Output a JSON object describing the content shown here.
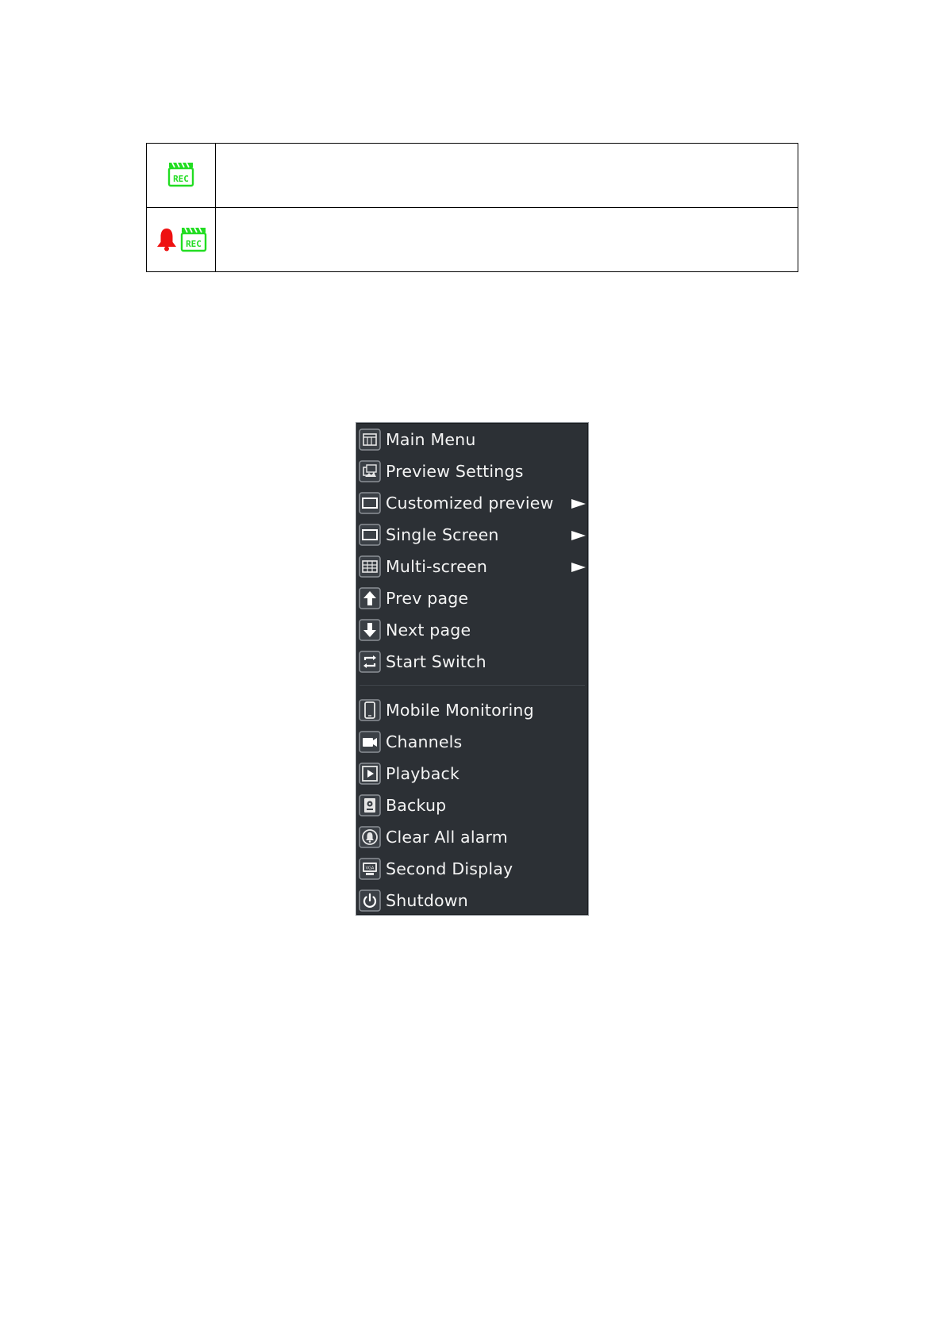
{
  "legend": {
    "rows": [
      {
        "icons": [
          "rec-icon"
        ],
        "description": ""
      },
      {
        "icons": [
          "alarm-bell-icon",
          "rec-icon"
        ],
        "description": ""
      }
    ],
    "colors": {
      "rec": "#22dd22",
      "alarm": "#ee1111"
    }
  },
  "context_menu": {
    "groups": [
      [
        {
          "label": "Main Menu",
          "icon": "main-menu-icon",
          "submenu": false
        },
        {
          "label": "Preview Settings",
          "icon": "preview-settings-icon",
          "submenu": false
        },
        {
          "label": "Customized preview",
          "icon": "screen-icon",
          "submenu": true
        },
        {
          "label": "Single Screen",
          "icon": "screen-icon",
          "submenu": true
        },
        {
          "label": "Multi-screen",
          "icon": "multi-screen-icon",
          "submenu": true
        },
        {
          "label": "Prev page",
          "icon": "arrow-up-icon",
          "submenu": false
        },
        {
          "label": "Next page",
          "icon": "arrow-down-icon",
          "submenu": false
        },
        {
          "label": "Start Switch",
          "icon": "switch-icon",
          "submenu": false
        }
      ],
      [
        {
          "label": "Mobile Monitoring",
          "icon": "mobile-icon",
          "submenu": false
        },
        {
          "label": "Channels",
          "icon": "camera-icon",
          "submenu": false
        },
        {
          "label": "Playback",
          "icon": "playback-icon",
          "submenu": false
        },
        {
          "label": "Backup",
          "icon": "backup-icon",
          "submenu": false
        },
        {
          "label": "Clear All alarm",
          "icon": "clear-alarm-icon",
          "submenu": false
        },
        {
          "label": "Second Display",
          "icon": "second-display-icon",
          "submenu": false
        },
        {
          "label": "Shutdown",
          "icon": "power-icon",
          "submenu": false
        }
      ]
    ],
    "colors": {
      "background": "#2c3035",
      "text": "#f4f4f4",
      "icon_frame": "#8b9096"
    }
  }
}
